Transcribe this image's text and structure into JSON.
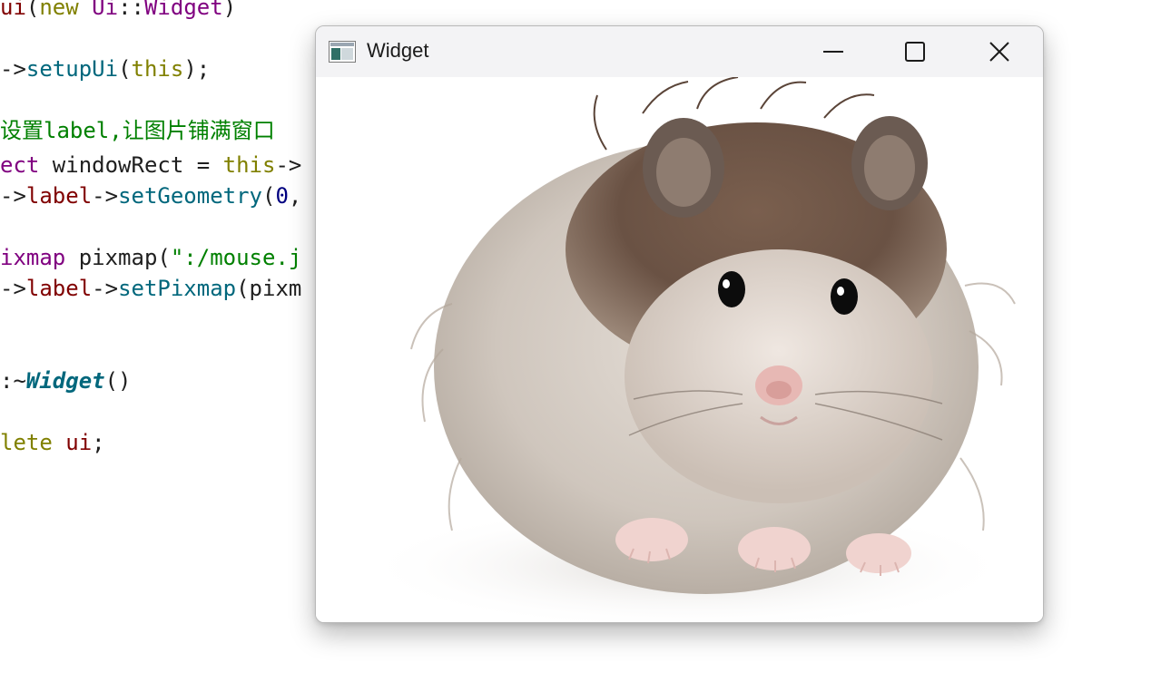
{
  "editor": {
    "lines": [
      {
        "parts": [
          {
            "t": "ui",
            "c": "mem"
          },
          {
            "t": "(",
            "c": ""
          },
          {
            "t": "new",
            "c": "kw"
          },
          {
            "t": " ",
            "c": ""
          },
          {
            "t": "Ui",
            "c": "ty"
          },
          {
            "t": "::",
            "c": ""
          },
          {
            "t": "Widget",
            "c": "ty"
          },
          {
            "t": ")",
            "c": ""
          }
        ]
      },
      {
        "parts": [
          {
            "t": "->",
            "c": ""
          },
          {
            "t": "setupUi",
            "c": "fn"
          },
          {
            "t": "(",
            "c": ""
          },
          {
            "t": "this",
            "c": "kw"
          },
          {
            "t": ");",
            "c": ""
          }
        ]
      },
      {
        "parts": [
          {
            "t": "设置label,让图片铺满窗口",
            "c": "cm"
          }
        ]
      },
      {
        "parts": [
          {
            "t": "ect",
            "c": "ty"
          },
          {
            "t": " windowRect = ",
            "c": ""
          },
          {
            "t": "this",
            "c": "kw"
          },
          {
            "t": "->",
            "c": ""
          }
        ]
      },
      {
        "parts": [
          {
            "t": "->",
            "c": ""
          },
          {
            "t": "label",
            "c": "mem"
          },
          {
            "t": "->",
            "c": ""
          },
          {
            "t": "setGeometry",
            "c": "fn"
          },
          {
            "t": "(",
            "c": ""
          },
          {
            "t": "0",
            "c": "num"
          },
          {
            "t": ",",
            "c": ""
          }
        ]
      },
      {
        "parts": [
          {
            "t": "ixmap",
            "c": "ty"
          },
          {
            "t": " pixmap(",
            "c": ""
          },
          {
            "t": "\":/mouse.j",
            "c": "str"
          }
        ]
      },
      {
        "parts": [
          {
            "t": "->",
            "c": ""
          },
          {
            "t": "label",
            "c": "mem"
          },
          {
            "t": "->",
            "c": ""
          },
          {
            "t": "setPixmap",
            "c": "fn"
          },
          {
            "t": "(pixm",
            "c": ""
          }
        ]
      },
      {
        "parts": [
          {
            "t": ":~",
            "c": ""
          },
          {
            "t": "Widget",
            "c": "fi"
          },
          {
            "t": "()",
            "c": ""
          }
        ]
      },
      {
        "parts": [
          {
            "t": "lete",
            "c": "kw"
          },
          {
            "t": " ",
            "c": ""
          },
          {
            "t": "ui",
            "c": "mem"
          },
          {
            "t": ";",
            "c": ""
          }
        ]
      }
    ]
  },
  "window": {
    "title": "Widget",
    "icon": "qt-window-icon",
    "controls": [
      "minimize-icon",
      "maximize-icon",
      "close-icon"
    ],
    "content": "hamster-photo"
  }
}
